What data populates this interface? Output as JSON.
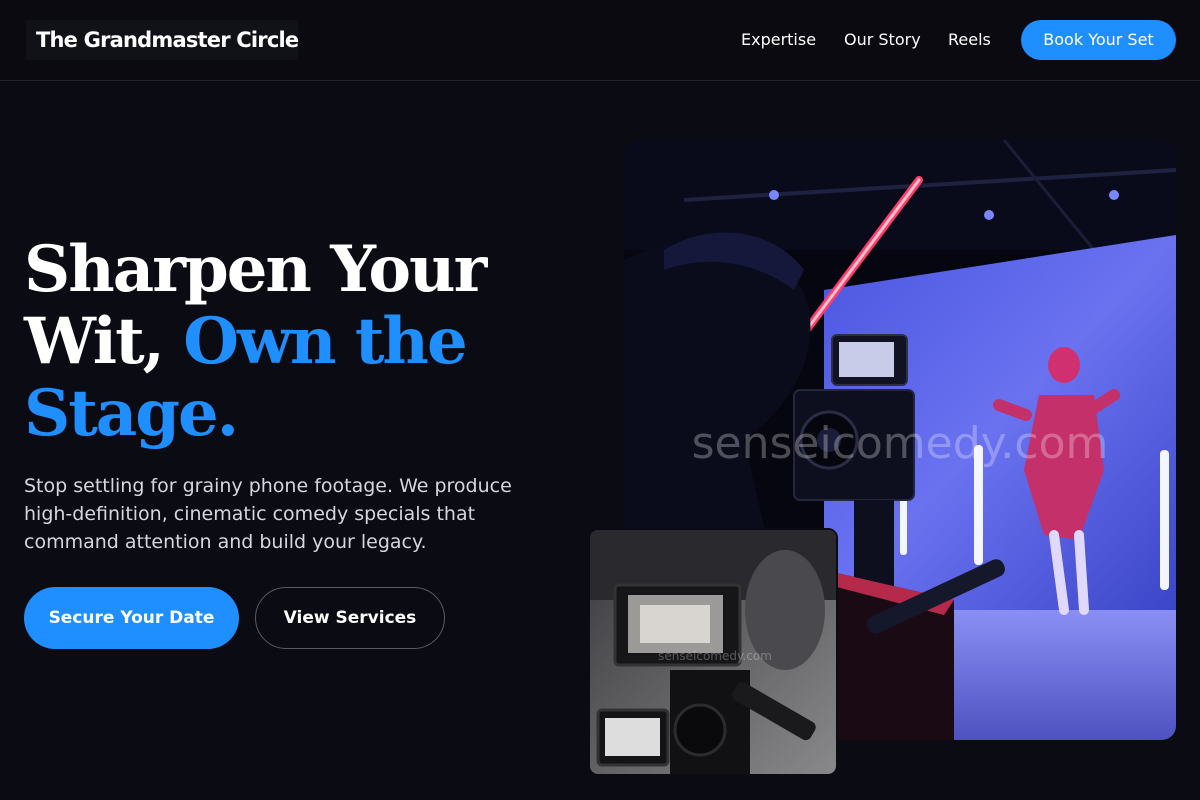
{
  "nav": {
    "logo": "The Grandmaster Circle",
    "links": [
      "Expertise",
      "Our Story",
      "Reels"
    ],
    "cta": "Book Your Set"
  },
  "hero": {
    "headline_line1": "Sharpen Your",
    "headline_line2_a": "Wit, ",
    "headline_line2_b": "Own the",
    "headline_line3": "Stage.",
    "subcopy": "Stop settling for grainy phone footage. We produce high-definition, cinematic comedy specials that command attention and build your legacy.",
    "primary_button": "Secure Your Date",
    "secondary_button": "View Services"
  },
  "images": {
    "main_watermark": "senseicomedy.com",
    "inset_watermark": "senseicomedy.com"
  },
  "colors": {
    "background": "#0b0b14",
    "accent": "#1f8fff"
  }
}
